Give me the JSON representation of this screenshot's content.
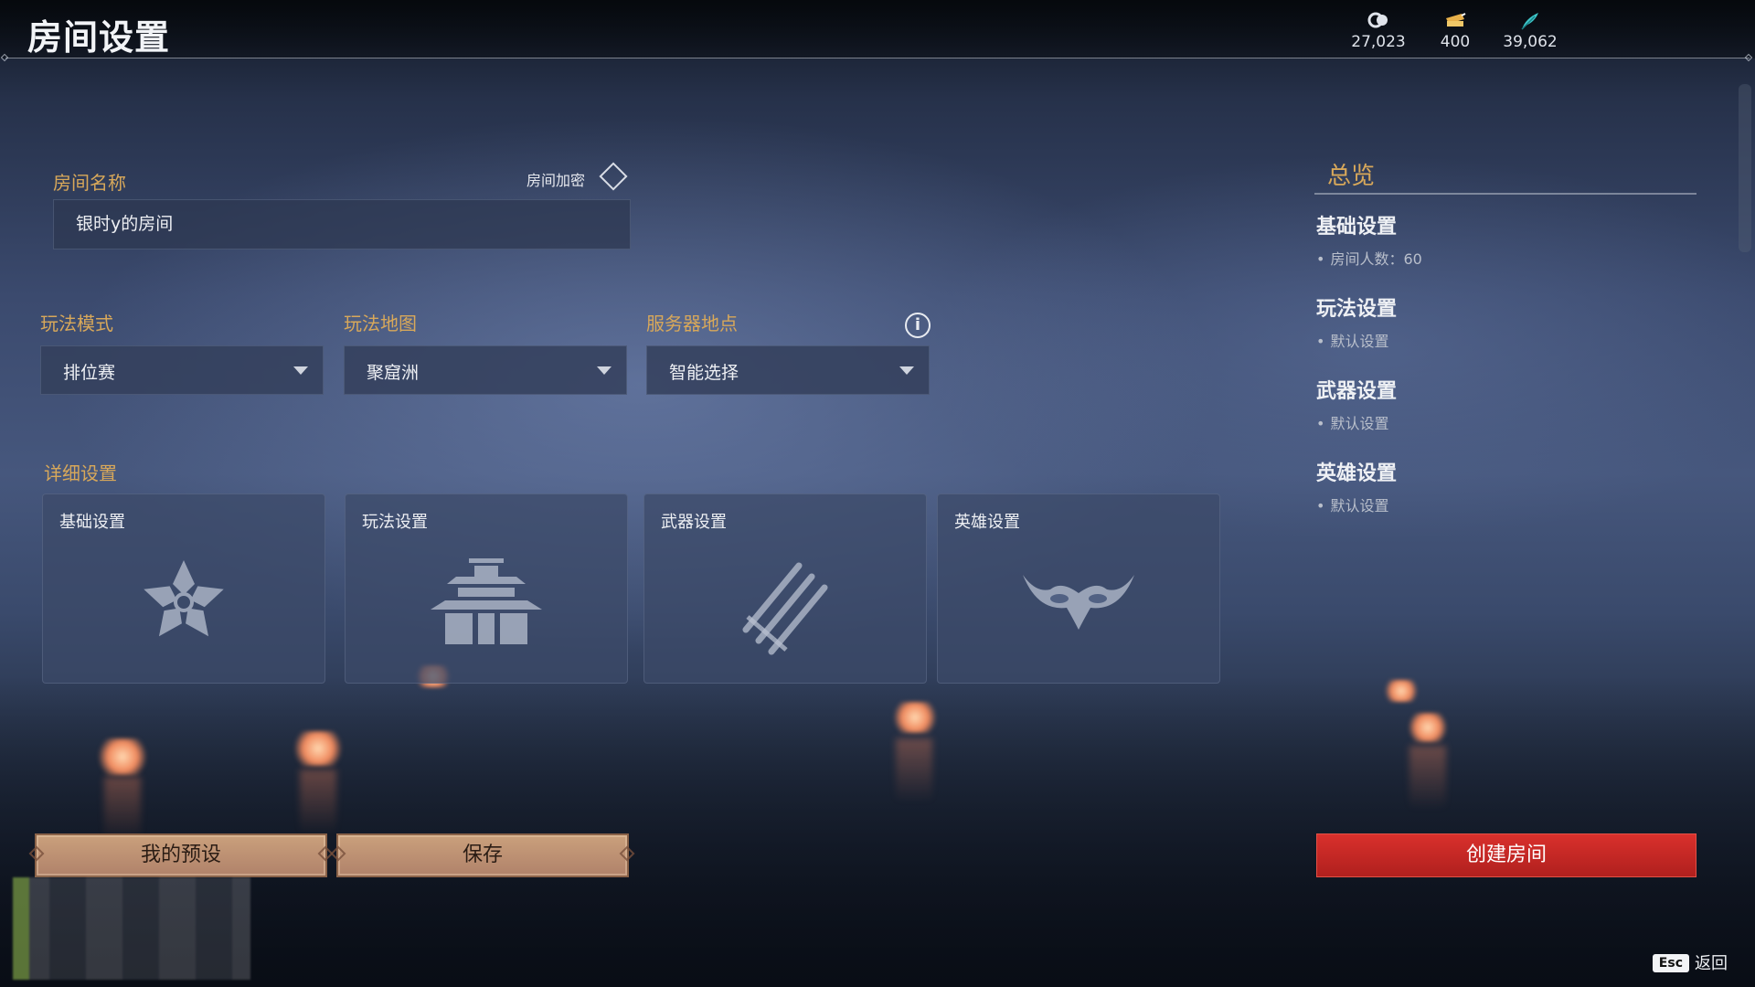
{
  "header": {
    "title": "房间设置",
    "currencies": [
      {
        "icon": "coin-icon",
        "value": "27,023"
      },
      {
        "icon": "gold-ticket-icon",
        "value": "400"
      },
      {
        "icon": "feather-icon",
        "value": "39,062"
      }
    ]
  },
  "room": {
    "name_label": "房间名称",
    "name_value": "银时y的房间",
    "lock_label": "房间加密"
  },
  "dropdowns": {
    "mode": {
      "label": "玩法模式",
      "value": "排位赛"
    },
    "map": {
      "label": "玩法地图",
      "value": "聚窟洲"
    },
    "server": {
      "label": "服务器地点",
      "value": "智能选择"
    }
  },
  "details": {
    "label": "详细设置",
    "cards": [
      {
        "title": "基础设置",
        "icon": "flower-icon"
      },
      {
        "title": "玩法设置",
        "icon": "pagoda-icon"
      },
      {
        "title": "武器设置",
        "icon": "swords-icon"
      },
      {
        "title": "英雄设置",
        "icon": "mask-icon"
      }
    ]
  },
  "overview": {
    "title": "总览",
    "sections": [
      {
        "title": "基础设置",
        "detail": "房间人数：60"
      },
      {
        "title": "玩法设置",
        "detail": "默认设置"
      },
      {
        "title": "武器设置",
        "detail": "默认设置"
      },
      {
        "title": "英雄设置",
        "detail": "默认设置"
      }
    ]
  },
  "buttons": {
    "presets": "我的预设",
    "save": "保存",
    "create": "创建房间"
  },
  "footer": {
    "esc_key": "Esc",
    "back": "返回"
  },
  "colors": {
    "accent_gold": "#d8a85a",
    "create_red": "#c8282a",
    "button_tan": "#bf927a"
  }
}
